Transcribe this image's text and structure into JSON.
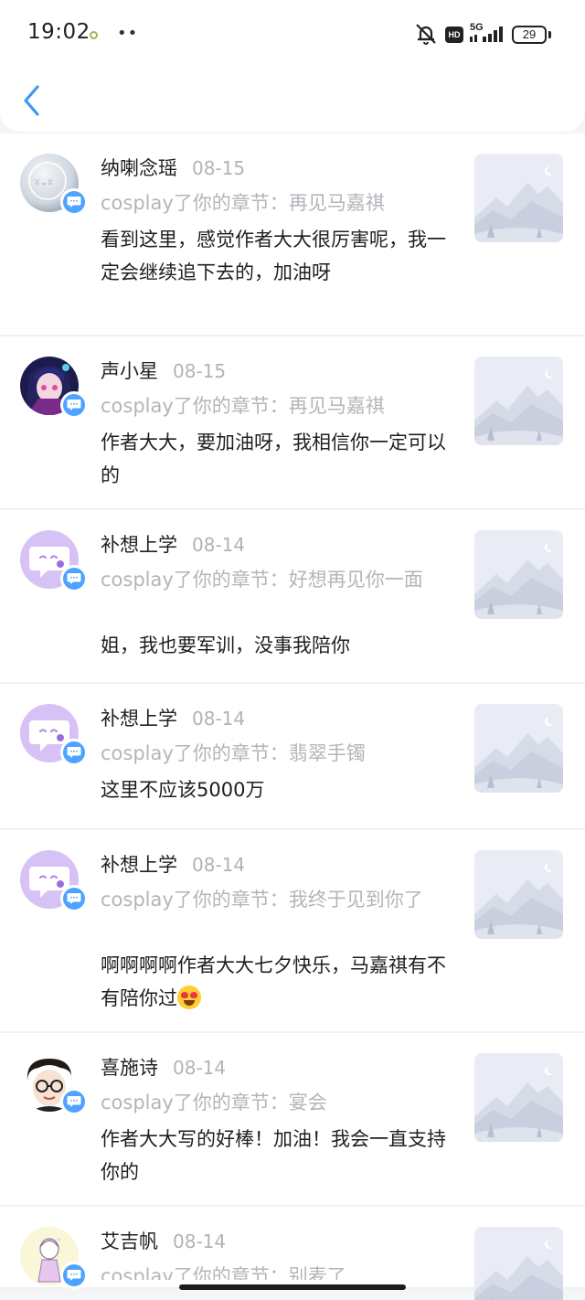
{
  "status_bar": {
    "time": "19:02",
    "more": "••",
    "hd": "HD",
    "network": "5G",
    "battery": "29",
    "battery_level_pct": 29
  },
  "header": {
    "back_icon": "chevron-left-icon"
  },
  "colors": {
    "accent": "#4da3ff",
    "muted": "#b3b5ba",
    "avatar_lilac": "#d7c2f5"
  },
  "notifications": [
    {
      "name": "纳喇念瑶",
      "date": "08-15",
      "chapter": "cosplay了你的章节：再见马嘉祺",
      "comment": "看到这里，感觉作者大大很厉害呢，我一定会继续追下去的，加油呀",
      "avatar": "bubble-photo-avatar"
    },
    {
      "name": "声小星",
      "date": "08-15",
      "chapter": "cosplay了你的章节：再见马嘉祺",
      "comment": "作者大大，要加油呀，我相信你一定可以的",
      "avatar": "anime-girl-avatar"
    },
    {
      "name": "补想上学",
      "date": "08-14",
      "chapter": "cosplay了你的章节：好想再见你一面",
      "comment": "姐，我也要军训，没事我陪你",
      "avatar": "default-chat-avatar"
    },
    {
      "name": "补想上学",
      "date": "08-14",
      "chapter": "cosplay了你的章节：翡翠手镯",
      "comment": "这里不应该5000万",
      "avatar": "default-chat-avatar"
    },
    {
      "name": "补想上学",
      "date": "08-14",
      "chapter": "cosplay了你的章节：我终于见到你了",
      "comment": "啊啊啊啊作者大大七夕快乐，马嘉祺有不有陪你过",
      "emoji": "heart-eyes-emoji",
      "avatar": "default-chat-avatar"
    },
    {
      "name": "喜施诗",
      "date": "08-14",
      "chapter": "cosplay了你的章节：宴会",
      "comment": "作者大大写的好棒！加油！我会一直支持你的",
      "avatar": "cartoon-glasses-avatar"
    },
    {
      "name": "艾吉帆",
      "date": "08-14",
      "chapter": "cosplay了你的章节：别麦了",
      "comment": "",
      "avatar": "sketch-girl-avatar"
    }
  ]
}
